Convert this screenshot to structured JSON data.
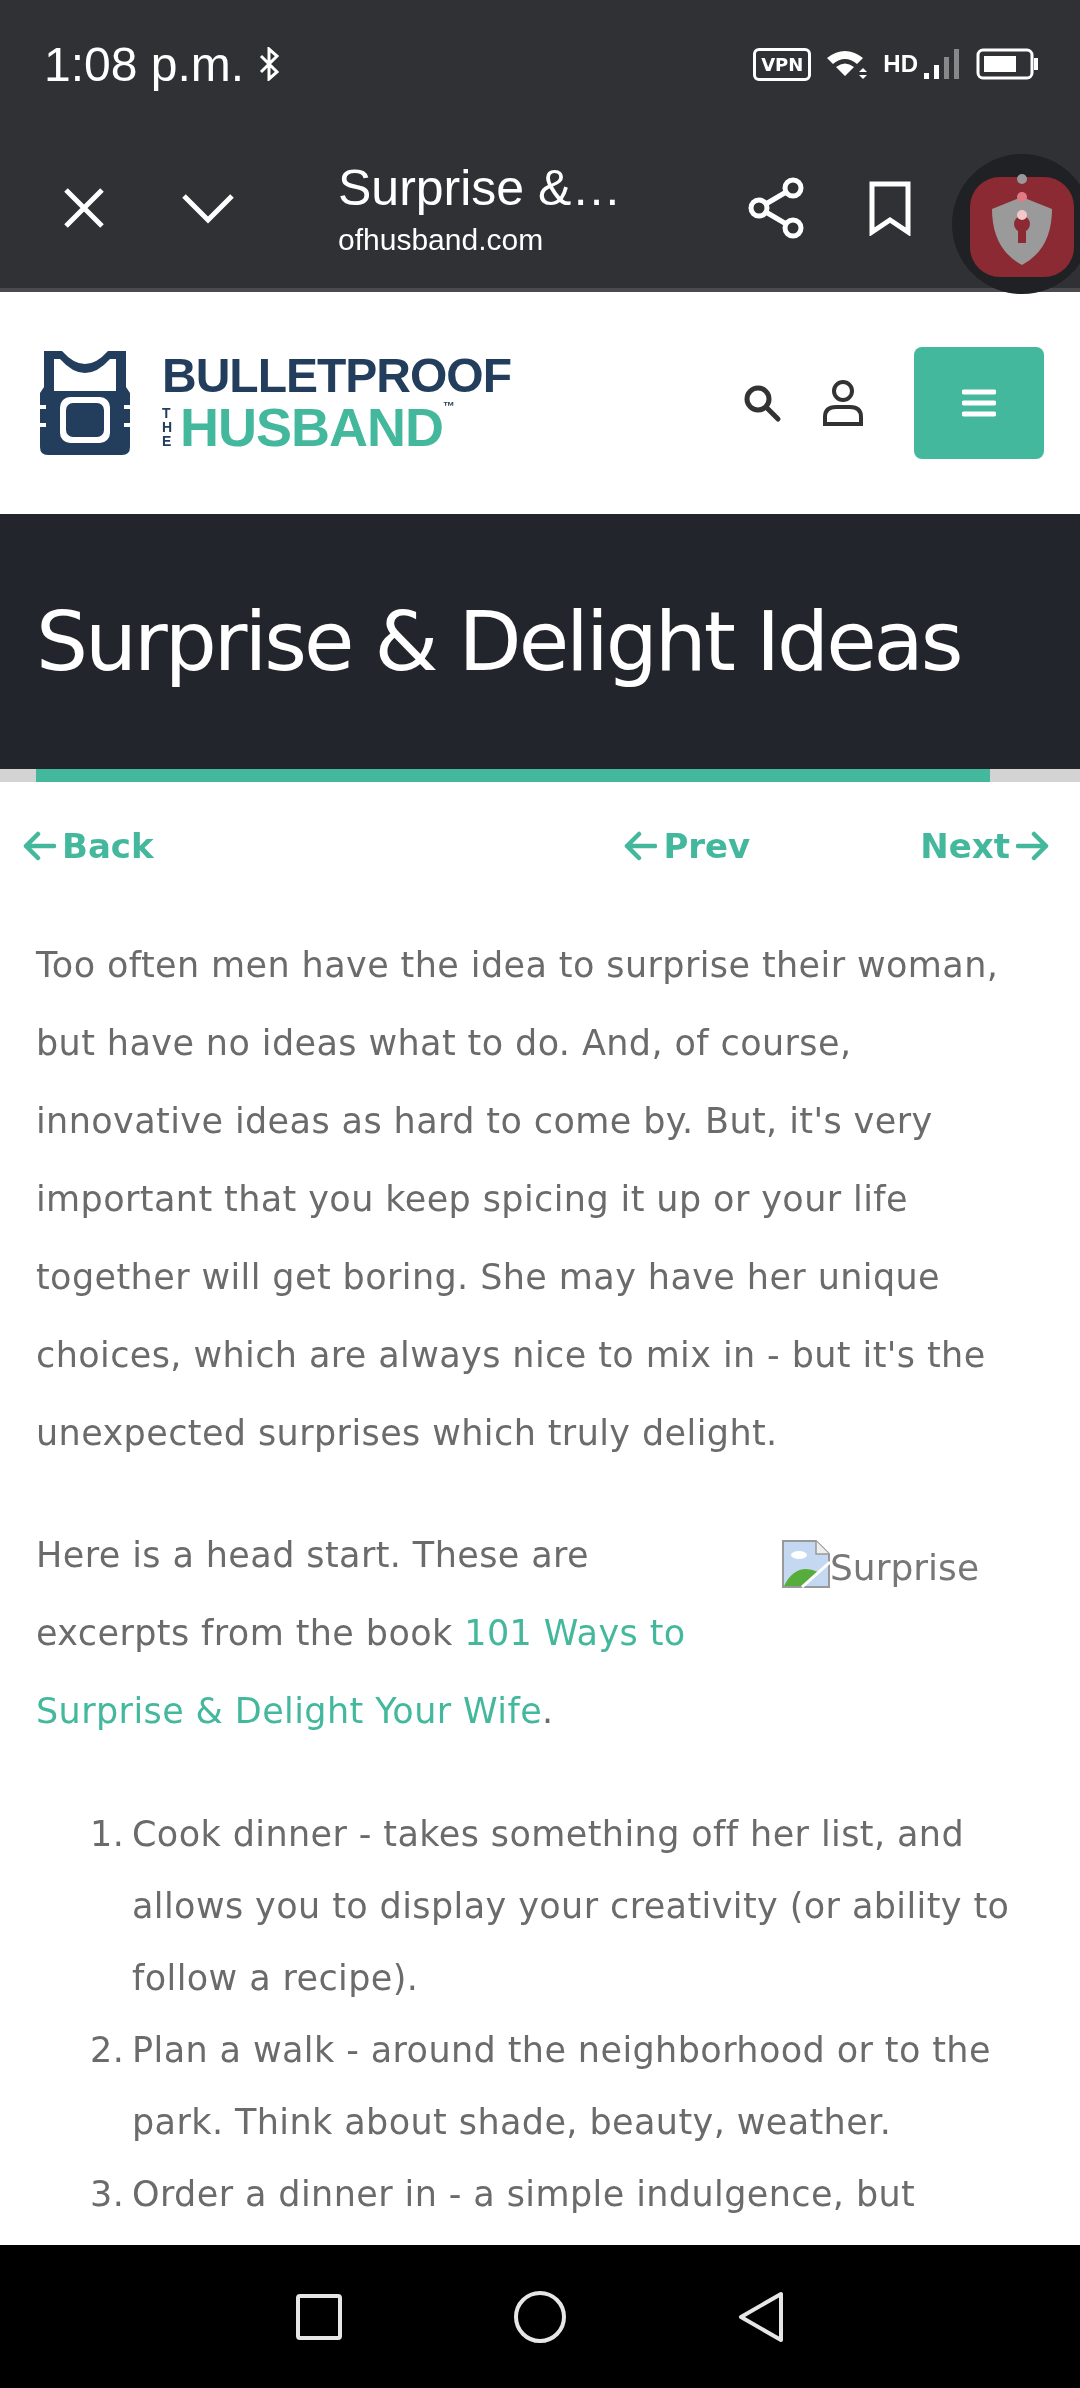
{
  "status_bar": {
    "time": "1:08 p.m.",
    "vpn": "VPN",
    "network": "HD"
  },
  "browser_toolbar": {
    "title": "Surprise &…",
    "url": "ofhusband.com"
  },
  "site_header": {
    "logo": {
      "top": "BULLETPROOF",
      "side": "THE",
      "bottom": "HUSBAND",
      "mark": "™"
    }
  },
  "page_title": "Surprise & Delight Ideas",
  "progress": {
    "level": 0.914
  },
  "post_nav": [
    {
      "label": "Back",
      "kind": "back"
    },
    {
      "label": "Prev",
      "kind": "back"
    },
    {
      "label": "Next",
      "kind": "forward"
    }
  ],
  "intro": "Too often men have the idea to surprise their woman, but have no ideas what to do. And, of course, innovative ideas as hard to come by. But, it's very important that you keep spicing it up or your life together will get boring. She may have her unique choices, which are always nice to mix in - but it's the unexpected surprises which truly delight.",
  "head_start": {
    "text": "Here is a head start. These are excerpts from the book ",
    "link_lines": [
      "101 Ways to",
      "Surprise & Delight Your Wife"
    ],
    "after": ".",
    "image_alt": "Surprise"
  },
  "ideas": [
    {
      "number": "1.",
      "text": "Cook dinner - takes something off her list, and allows you to display your creativity (or ability to follow a recipe)."
    },
    {
      "number": "2.",
      "text": "Plan a walk - around the neighborhood or to the park. Think about shade, beauty, weather."
    },
    {
      "number": "3.",
      "text": "Order a dinner in - a simple indulgence, but"
    }
  ]
}
